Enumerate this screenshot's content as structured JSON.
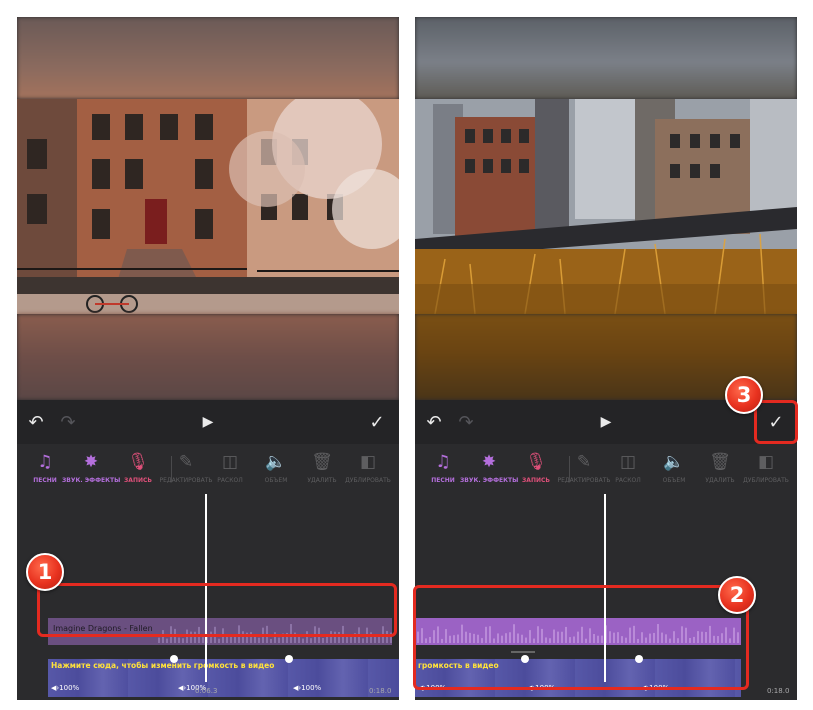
{
  "colors": {
    "accent": "#b46fdc",
    "mic": "#e0507a",
    "callout_red": "#e42a20",
    "hint_yellow": "#ffe23a",
    "audio_track": "#6a4f80",
    "audio_track_selected": "#9b62c4",
    "video_track": "#4a4aa0"
  },
  "icons": {
    "undo": "↶",
    "redo": "↷",
    "play": "▶",
    "confirm": "✓"
  },
  "tools": {
    "songs": "ПЕСНИ",
    "sound_effects": "ЗВУК. ЭФФЕКТЫ",
    "record": "ЗАПИСЬ",
    "edit": "РЕДАКТИРОВАТЬ",
    "split": "РАСКОЛ",
    "volume": "ОБЪЕМ",
    "delete": "УДАЛИТЬ",
    "duplicate": "ДУБЛИРОВАТЬ"
  },
  "left_panel": {
    "audio_track_name": "Imagine Dragons - Fallen",
    "video_hint": "Нажмите сюда, чтобы изменить громкость в видео",
    "volume_labels": [
      "◀›100%",
      "◀›100%",
      "◀›100%"
    ],
    "current_time": "0:06.3",
    "end_time": "0:18.0"
  },
  "right_panel": {
    "video_hint": "громкость в видео",
    "volume_labels": [
      "◀›100%",
      "◀›100%",
      "◀›100%"
    ],
    "end_time": "0:18.0"
  },
  "callouts": {
    "one": "1",
    "two": "2",
    "three": "3"
  }
}
